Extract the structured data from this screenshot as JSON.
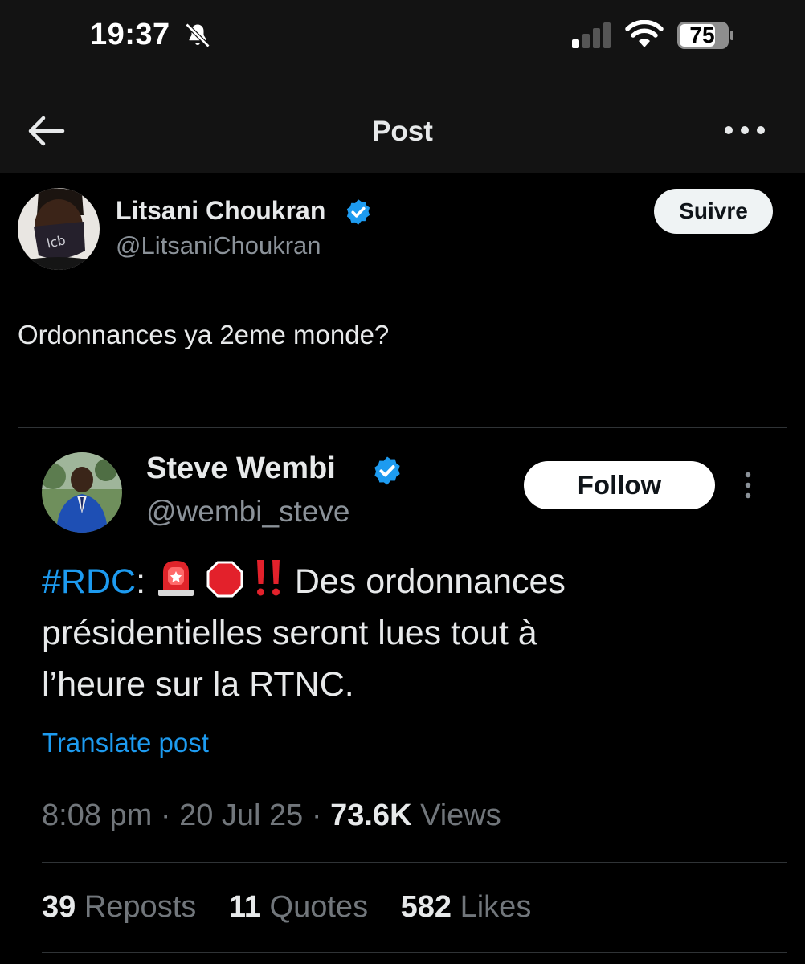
{
  "status_bar": {
    "time": "19:37",
    "battery": "75",
    "icons": [
      "bell-slash-icon",
      "cellular-signal-icon",
      "wifi-icon",
      "battery-icon"
    ]
  },
  "nav": {
    "title": "Post",
    "back_icon": "arrow-left-icon",
    "more_icon": "more-horizontal-icon"
  },
  "post": {
    "author_name": "Litsani Choukran",
    "author_handle": "@LitsaniChoukran",
    "follow_label": "Suivre",
    "text": "Ordonnances ya 2eme monde?"
  },
  "quoted": {
    "author_name": "Steve Wembi",
    "author_handle": "@wembi_steve",
    "follow_label": "Follow",
    "hashtag": "#RDC",
    "colon": ":",
    "text_line1": "Des ordonnances",
    "text_line2": "présidentielles seront lues tout à",
    "text_line3": "l’heure sur la RTNC.",
    "emojis": [
      "police-light-icon",
      "stop-sign-icon",
      "double-exclamation-icon"
    ],
    "translate_label": "Translate post",
    "time": "8:08 pm",
    "sep": "·",
    "date": "20 Jul 25",
    "views_count": "73.6K",
    "views_label": "Views",
    "reposts_count": "39",
    "reposts_label": "Reposts",
    "quotes_count": "11",
    "quotes_label": "Quotes",
    "likes_count": "582",
    "likes_label": "Likes"
  },
  "colors": {
    "background": "#000000",
    "bar_background": "#131313",
    "text": "#e7e9ea",
    "secondary_text": "#71767b",
    "link": "#1d9bf0",
    "verified": "#1d9bf0"
  }
}
